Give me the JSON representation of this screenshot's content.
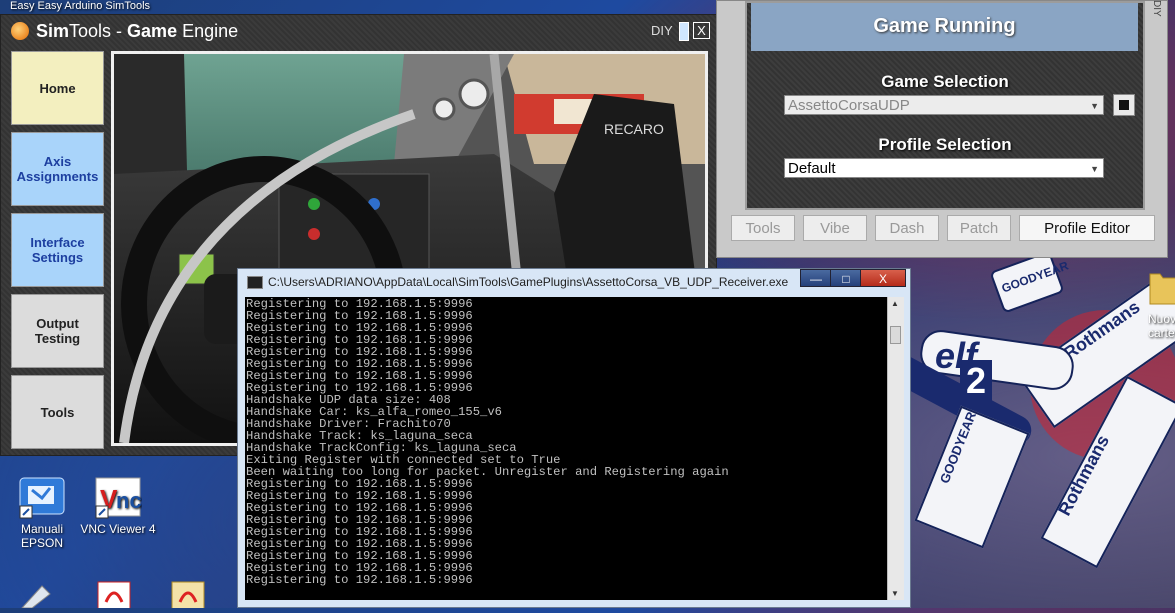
{
  "desktop": {
    "top_icons": "Easy Easy     Arduino      SimTools",
    "icons": [
      {
        "label": "Manuali\nEPSON",
        "icon": "epson-manual-icon"
      },
      {
        "label": "VNC Viewer 4",
        "icon": "vnc-viewer-icon"
      },
      {
        "label": "Nuova\ncarte",
        "icon": "folder-icon"
      }
    ],
    "car_texts": {
      "goodyear1": "GOODYEAR",
      "goodyear2": "GOODYEAR",
      "rothmans1": "Rothmans",
      "rothmans2": "Rothmans",
      "elf": "elf",
      "number": "2"
    }
  },
  "simtools": {
    "title_prefix": "Sim",
    "title_mid": "Tools - ",
    "title_game": "Game",
    "title_suffix": " Engine",
    "diy_label": "DIY",
    "close_label": "X",
    "nav": [
      {
        "label": "Home"
      },
      {
        "label": "Axis Assignments"
      },
      {
        "label": "Interface Settings"
      },
      {
        "label": "Output Testing"
      },
      {
        "label": "Tools"
      }
    ],
    "photo": {
      "seat_brand": "RECARO"
    }
  },
  "game_panel": {
    "status": "Game Running",
    "game_selection_label": "Game Selection",
    "game_selection_value": "AssettoCorsaUDP",
    "profile_selection_label": "Profile Selection",
    "profile_selection_value": "Default",
    "tabs": [
      "Tools",
      "Vibe",
      "Dash",
      "Patch",
      "Profile Editor"
    ],
    "side_label": "DIY"
  },
  "console": {
    "title": "C:\\Users\\ADRIANO\\AppData\\Local\\SimTools\\GamePlugins\\AssettoCorsa_VB_UDP_Receiver.exe",
    "minimize": "—",
    "maximize": "□",
    "close": "X",
    "lines": [
      "Registering to 192.168.1.5:9996",
      "Registering to 192.168.1.5:9996",
      "Registering to 192.168.1.5:9996",
      "Registering to 192.168.1.5:9996",
      "Registering to 192.168.1.5:9996",
      "Registering to 192.168.1.5:9996",
      "Registering to 192.168.1.5:9996",
      "Registering to 192.168.1.5:9996",
      "Handshake UDP data size: 408",
      "Handshake Car: ks_alfa_romeo_155_v6",
      "Handshake Driver: Frachito70",
      "Handshake Track: ks_laguna_seca",
      "Handshake TrackConfig: ks_laguna_seca",
      "Exiting Register with connected set to True",
      "Been waiting too long for packet. Unregister and Registering again",
      "Registering to 192.168.1.5:9996",
      "Registering to 192.168.1.5:9996",
      "Registering to 192.168.1.5:9996",
      "Registering to 192.168.1.5:9996",
      "Registering to 192.168.1.5:9996",
      "Registering to 192.168.1.5:9996",
      "Registering to 192.168.1.5:9996",
      "Registering to 192.168.1.5:9996",
      "Registering to 192.168.1.5:9996"
    ]
  }
}
